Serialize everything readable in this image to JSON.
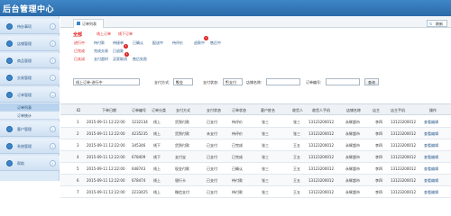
{
  "app_title": "后台管理中心",
  "sidebar": {
    "sections": [
      {
        "label": "待办事项"
      },
      {
        "label": "店铺管理"
      },
      {
        "label": "商品管理"
      },
      {
        "label": "交易管理"
      },
      {
        "label": "订单管理"
      },
      {
        "label": "客户管理"
      },
      {
        "label": "系统管理"
      },
      {
        "label": "帮助"
      }
    ],
    "subitems": [
      {
        "label": "订单列表"
      },
      {
        "label": "订单统计"
      }
    ]
  },
  "tabs": {
    "active": "订单列表",
    "refresh": "刷新"
  },
  "filters": {
    "all": "全部",
    "type_row": {
      "label1": "线上订单",
      "label2": "线下订单"
    },
    "status_row_label": "进行中",
    "status_items": [
      "待付款",
      "待接单",
      "已确认",
      "配送中",
      "待评价",
      "退款中",
      "售后中"
    ],
    "done_row_label": "已完成",
    "done_items": [
      "完成交易",
      "已退款"
    ],
    "closed_row_label": "已关闭",
    "closed_items": [
      "支付超时",
      "买家取消",
      "售后失败"
    ],
    "badges": [
      "1",
      "1",
      "1"
    ]
  },
  "search": {
    "order_type_value": "线上订单-进行中",
    "pay_method_label": "支付方式:",
    "pay_method_value": "现金",
    "pay_status_label": "支付状态:",
    "pay_status_value": "已支付",
    "shop_name_label": "店铺名称:",
    "order_no_label": "订单编号:",
    "search_button": "查询"
  },
  "table": {
    "columns": [
      "ID",
      "下单日期",
      "订单编号",
      "订单分类",
      "支付方式",
      "支付状态",
      "订单状态",
      "客户姓名",
      "收货人",
      "收货人手机",
      "店铺名称",
      "店主",
      "店主手机",
      "操作"
    ],
    "rows": [
      [
        "1",
        "2015-09-11 12:22:00",
        "1232134",
        "线上",
        "货到付款",
        "已支付",
        "待评价",
        "张三",
        "张三",
        "13123200012",
        "永辉超市",
        "李四",
        "13123200012",
        "查看编辑"
      ],
      [
        "2",
        "2015-09-11 12:22:00",
        "4235235",
        "线上",
        "货到付款",
        "未支付",
        "待评价",
        "张三",
        "张三",
        "13123200012",
        "永辉超市",
        "李四",
        "13123200012",
        "查看编辑"
      ],
      [
        "3",
        "2015-09-11 12:22:00",
        "345346",
        "线下",
        "货到付款",
        "已支付",
        "已完成",
        "张三",
        "王五",
        "13123200012",
        "永辉超市",
        "李四",
        "13123200012",
        "查看编辑"
      ],
      [
        "4",
        "2015-09-11 12:22:00",
        "678409",
        "线下",
        "支付宝",
        "已支付",
        "已完成",
        "张三",
        "王五",
        "13123200012",
        "永辉超市",
        "李四",
        "13123200012",
        "查看编辑"
      ],
      [
        "5",
        "2015-09-11 12:22:00",
        "648743",
        "线上",
        "现金付款",
        "已支付",
        "已确认",
        "张三",
        "王五",
        "13123200012",
        "永辉超市",
        "李四",
        "13123200012",
        "查看编辑"
      ],
      [
        "6",
        "2015-09-11 12:22:00",
        "678474",
        "线上",
        "银行卡",
        "已支付",
        "待付款",
        "张三",
        "王五",
        "13123200012",
        "永辉超市",
        "李四",
        "13123200012",
        "查看编辑"
      ],
      [
        "7",
        "2015-09-11 12:22:00",
        "2233425",
        "线上",
        "微信支付",
        "已支付",
        "待付款",
        "张三",
        "王五",
        "13123200012",
        "永辉超市",
        "李四",
        "13123200012",
        "查看编辑"
      ]
    ]
  },
  "colors": {
    "header": "#2f78bd",
    "sidebar": "#dce9f6",
    "accent_red": "#dd2222"
  }
}
